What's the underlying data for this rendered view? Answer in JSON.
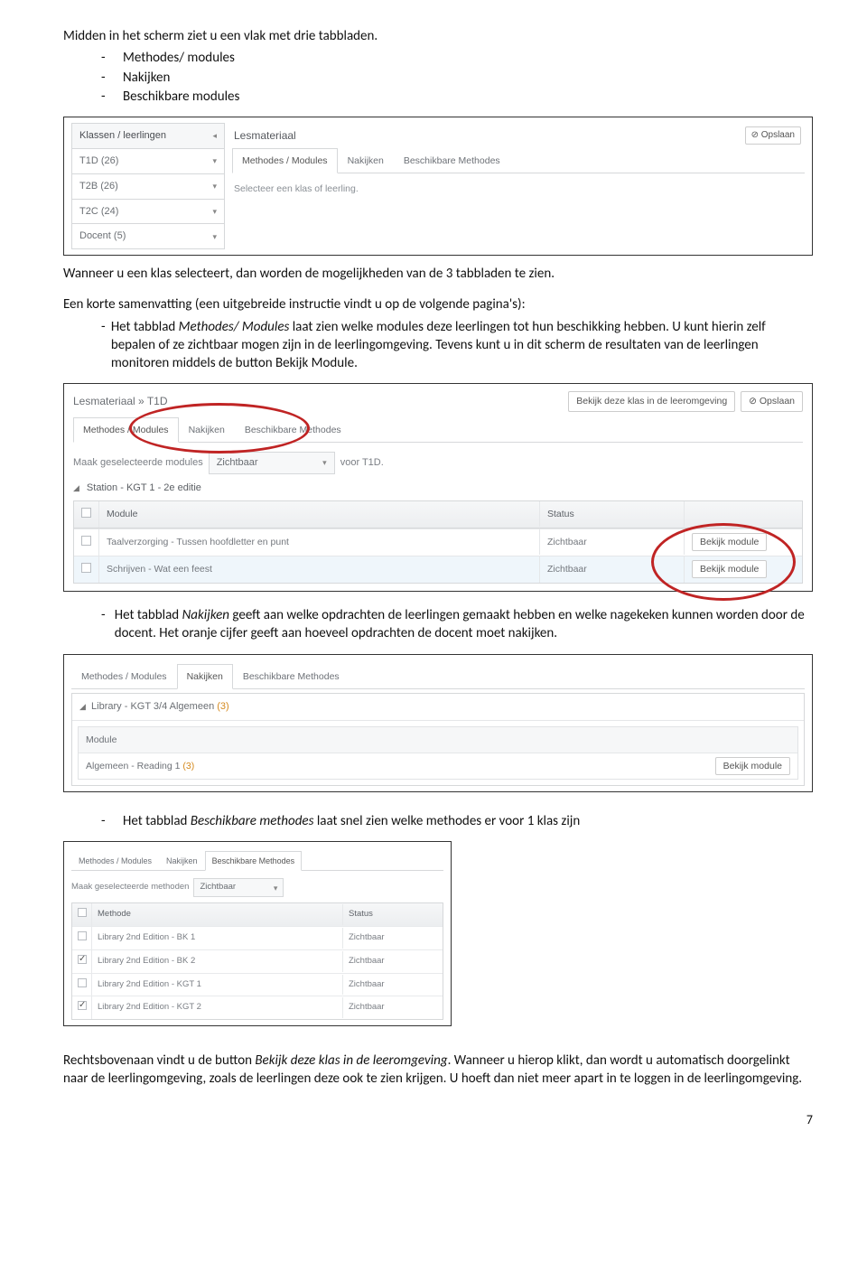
{
  "text": {
    "p1": "Midden in het scherm ziet u een vlak met drie tabbladen.",
    "list1": [
      "Methodes/ modules",
      "Nakijken",
      "Beschikbare modules"
    ],
    "p2": "Wanneer u een klas selecteert, dan worden de mogelijkheden van de 3 tabbladen te zien.",
    "p3a": "Een korte samenvatting (een uitgebreide instructie vindt u op de volgende pagina's):",
    "p3_item_prefix": "Het tabblad ",
    "p3_item_em": "Methodes/ Modules",
    "p3_item_rest": " laat zien welke modules deze leerlingen tot hun beschikking hebben. U kunt hierin zelf bepalen of ze zichtbaar mogen zijn in de leerlingomgeving. Tevens kunt u in dit scherm de resultaten van de leerlingen monitoren middels de button Bekijk Module.",
    "p4_prefix": "Het tabblad ",
    "p4_em": "Nakijken",
    "p4_rest": " geeft aan welke opdrachten de leerlingen gemaakt hebben en welke nagekeken kunnen worden door de docent. Het oranje cijfer geeft aan hoeveel opdrachten de docent moet nakijken.",
    "p5_prefix": "Het tabblad ",
    "p5_em": "Beschikbare methodes",
    "p5_rest": " laat snel zien welke methodes er voor 1 klas zijn",
    "p6a": "Rechtsbovenaan vindt u de button ",
    "p6em": "Bekijk deze klas in de leeromgeving",
    "p6b": ". Wanneer u hierop klikt, dan wordt u automatisch doorgelinkt naar de leerlingomgeving, zoals de leerlingen deze ook te zien krijgen. U hoeft dan niet meer apart in te loggen in de leerlingomgeving.",
    "pagenum": "7"
  },
  "shot1": {
    "side_head": "Klassen / leerlingen",
    "rows": [
      "T1D (26)",
      "T2B (26)",
      "T2C (24)",
      "Docent (5)"
    ],
    "section": "Lesmateriaal",
    "opslaan": "Opslaan",
    "tabs": [
      "Methodes / Modules",
      "Nakijken",
      "Beschikbare Methodes"
    ],
    "hint": "Selecteer een klas of leerling."
  },
  "shot2": {
    "breadcrumb": "Lesmateriaal  »  T1D",
    "btn_bekijk": "Bekijk deze klas in de leeromgeving",
    "opslaan": "Opslaan",
    "tabs": [
      "Methodes / Modules",
      "Nakijken",
      "Beschikbare Methodes"
    ],
    "maak_pre": "Maak geselecteerde modules",
    "sel": "Zichtbaar",
    "maak_post": "voor T1D.",
    "group": "Station - KGT 1 - 2e editie",
    "head_module": "Module",
    "head_status": "Status",
    "rows": [
      {
        "name": "Taalverzorging - Tussen hoofdletter en punt",
        "status": "Zichtbaar",
        "btn": "Bekijk module"
      },
      {
        "name": "Schrijven - Wat een feest",
        "status": "Zichtbaar",
        "btn": "Bekijk module"
      }
    ]
  },
  "shot3": {
    "tabs": [
      "Methodes / Modules",
      "Nakijken",
      "Beschikbare Methodes"
    ],
    "group": "Library - KGT 3/4 Algemeen",
    "group_count": "(3)",
    "head_module": "Module",
    "row_name": "Algemeen - Reading 1",
    "row_count": "(3)",
    "btn": "Bekijk module"
  },
  "shot4": {
    "tabs": [
      "Methodes / Modules",
      "Nakijken",
      "Beschikbare Methodes"
    ],
    "maak_pre": "Maak geselecteerde methoden",
    "sel": "Zichtbaar",
    "head_methode": "Methode",
    "head_status": "Status",
    "rows": [
      {
        "chk": false,
        "name": "Library 2nd Edition - BK 1",
        "status": "Zichtbaar"
      },
      {
        "chk": true,
        "name": "Library 2nd Edition - BK 2",
        "status": "Zichtbaar"
      },
      {
        "chk": false,
        "name": "Library 2nd Edition - KGT 1",
        "status": "Zichtbaar"
      },
      {
        "chk": true,
        "name": "Library 2nd Edition - KGT 2",
        "status": "Zichtbaar"
      }
    ]
  }
}
